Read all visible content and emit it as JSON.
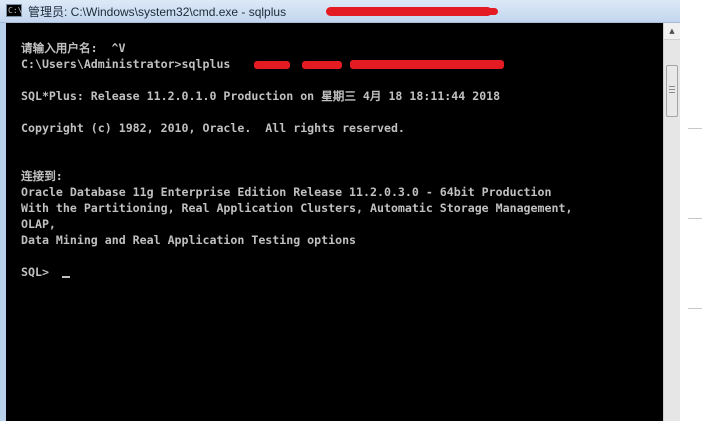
{
  "window": {
    "title": "管理员: C:\\Windows\\system32\\cmd.exe - sqlplus",
    "icon_label": "C:\\"
  },
  "console": {
    "lines": [
      "请输入用户名:  ^V",
      "C:\\Users\\Administrator>sqlplus",
      "SQL*Plus: Release 11.2.0.1.0 Production on 星期三 4月 18 18:11:44 2018",
      "Copyright (c) 1982, 2010, Oracle.  All rights reserved.",
      "连接到:",
      "Oracle Database 11g Enterprise Edition Release 11.2.0.3.0 - 64bit Production",
      "With the Partitioning, Real Application Clusters, Automatic Storage Management,",
      "OLAP,",
      "Data Mining and Real Application Testing options",
      "SQL> "
    ]
  },
  "colors": {
    "console_background": "#000000",
    "console_text": "#c0c0c0",
    "redaction": "#e51b23",
    "titlebar": "#c3d6ee"
  },
  "icons": {
    "app": "console-icon",
    "scroll_up": "up-arrow-icon"
  }
}
